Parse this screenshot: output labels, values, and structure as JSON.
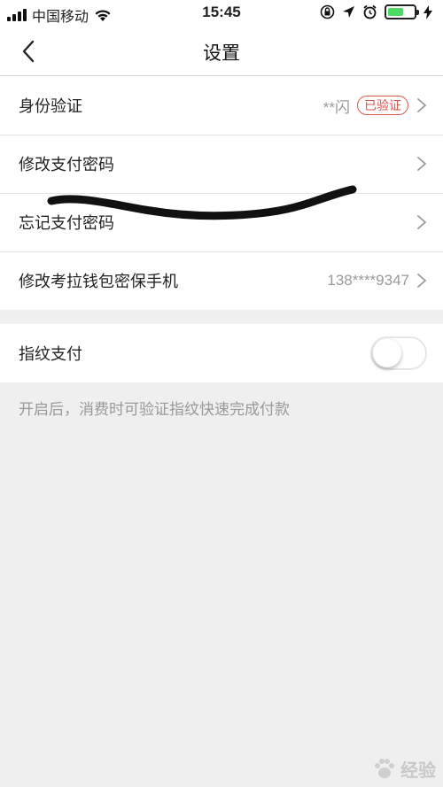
{
  "status_bar": {
    "carrier": "中国移动",
    "time": "15:45"
  },
  "nav": {
    "title": "设置"
  },
  "security_group": {
    "rows": [
      {
        "label": "身份验证",
        "value": "**闪",
        "badge": "已验证"
      },
      {
        "label": "修改支付密码"
      },
      {
        "label": "忘记支付密码"
      },
      {
        "label": "修改考拉钱包密保手机",
        "value": "138****9347"
      }
    ]
  },
  "fingerprint": {
    "label": "指纹支付",
    "enabled": false,
    "hint": "开启后，消费时可验证指纹快速完成付款"
  },
  "watermark": {
    "text": "经验"
  },
  "colors": {
    "badge": "#e2534a",
    "background": "#efefef",
    "battery": "#4cd964"
  }
}
